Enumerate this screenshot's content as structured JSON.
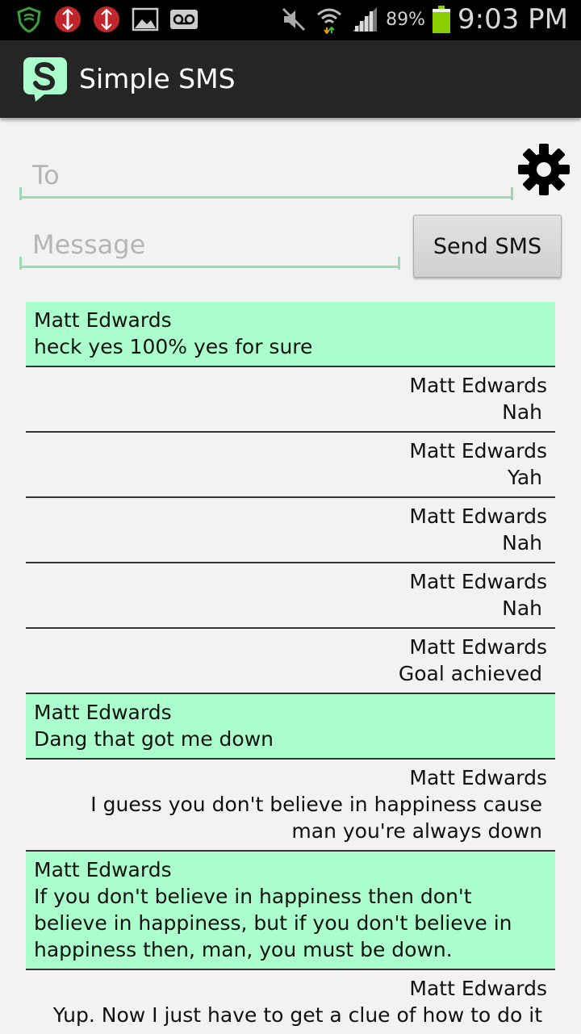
{
  "status_bar": {
    "battery_percent": "89%",
    "time": "9:03 PM",
    "icons": [
      "shield-icon",
      "no-entry-icon",
      "no-entry-icon",
      "image-icon",
      "voicemail-icon",
      "mute-icon",
      "wifi-icon",
      "signal-icon",
      "battery-icon"
    ]
  },
  "app": {
    "title": "Simple SMS",
    "accent_color": "#aaffcc"
  },
  "compose": {
    "to_placeholder": "To",
    "message_placeholder": "Message",
    "send_label": "Send SMS"
  },
  "messages": [
    {
      "sender": "Matt Edwards",
      "body": "heck yes 100% yes for sure",
      "direction": "received"
    },
    {
      "sender": "Matt Edwards",
      "body": "Nah",
      "direction": "sent"
    },
    {
      "sender": "Matt Edwards",
      "body": "Yah",
      "direction": "sent"
    },
    {
      "sender": "Matt Edwards",
      "body": "Nah",
      "direction": "sent"
    },
    {
      "sender": "Matt Edwards",
      "body": "Nah",
      "direction": "sent"
    },
    {
      "sender": "Matt Edwards",
      "body": "Goal achieved",
      "direction": "sent"
    },
    {
      "sender": "Matt Edwards",
      "body": "Dang that got me down",
      "direction": "received"
    },
    {
      "sender": "Matt Edwards",
      "body": "I guess you don't believe in happiness cause man you're always down",
      "direction": "sent"
    },
    {
      "sender": "Matt Edwards",
      "body": "If you don't believe in happiness then don't believe in happiness, but if you don't believe in happiness then, man, you must be down.",
      "direction": "received"
    },
    {
      "sender": "Matt Edwards",
      "body": "Yup. Now I just have to get a clue of how to do it",
      "direction": "sent"
    }
  ]
}
